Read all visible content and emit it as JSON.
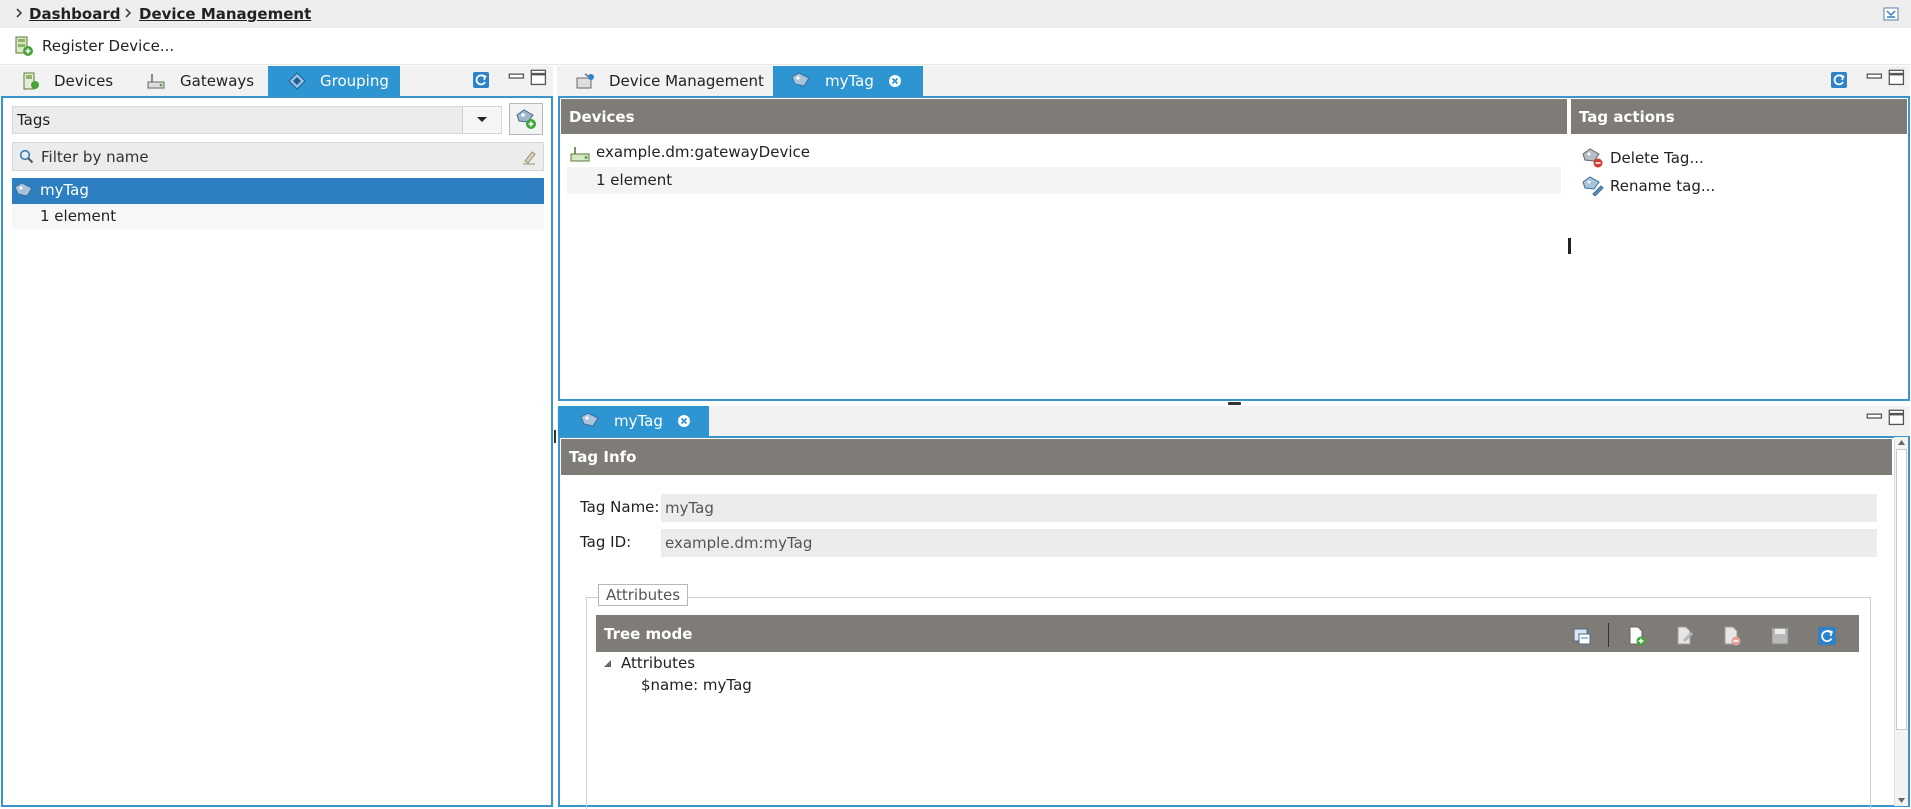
{
  "breadcrumb": {
    "items": [
      "Dashboard",
      "Device Management"
    ]
  },
  "toolbar": {
    "register_label": "Register Device..."
  },
  "left_tabs": {
    "devices": "Devices",
    "gateways": "Gateways",
    "grouping": "Grouping"
  },
  "grouping": {
    "combo_value": "Tags",
    "filter_placeholder": "Filter by name",
    "tags": [
      {
        "name": "myTag",
        "count_label": "1 element"
      }
    ]
  },
  "editor_tabs": {
    "device_management": "Device Management",
    "tag": "myTag"
  },
  "devices_section": {
    "header": "Devices",
    "items": [
      {
        "name": "example.dm:gatewayDevice"
      }
    ],
    "count_label": "1 element"
  },
  "tag_actions": {
    "header": "Tag actions",
    "delete_label": "Delete Tag...",
    "rename_label": "Rename tag..."
  },
  "detail_tab": {
    "label": "myTag"
  },
  "tag_info": {
    "header": "Tag Info",
    "name_label": "Tag Name:",
    "name_value": "myTag",
    "id_label": "Tag ID:",
    "id_value": "example.dm:myTag"
  },
  "attributes": {
    "legend": "Attributes",
    "mode_header": "Tree mode",
    "root_label": "Attributes",
    "entry": "$name: myTag"
  },
  "colors": {
    "accent": "#2d96d2",
    "selection": "#2d7fc1",
    "header_gray": "#7f7c77",
    "panel_border": "#3a95cc"
  },
  "icons": [
    "register-device-icon",
    "devices-icon",
    "gateways-icon",
    "grouping-icon",
    "refresh-icon",
    "minimize-icon",
    "maximize-icon",
    "add-tag-icon",
    "search-icon",
    "clear-filter-icon",
    "tag-icon",
    "gateway-device-icon",
    "delete-tag-icon",
    "rename-tag-icon",
    "close-icon",
    "tree-mode-icon",
    "new-attribute-icon",
    "edit-attribute-icon",
    "delete-attribute-icon",
    "save-icon",
    "chevron-right-icon",
    "tree-expanded-icon"
  ]
}
